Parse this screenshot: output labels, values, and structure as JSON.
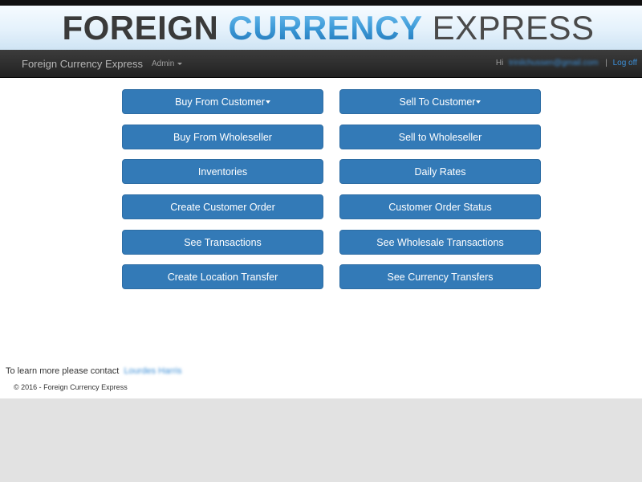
{
  "banner": {
    "logo_word1": "FOREIGN",
    "logo_word2": "CURRENCY",
    "logo_word3": "EXPRESS"
  },
  "navbar": {
    "brand": "Foreign Currency Express",
    "admin_menu": "Admin",
    "greeting": "Hi",
    "user_email": "trinilchussen@gmail.com",
    "separator": "|",
    "logoff": "Log off"
  },
  "buttons": {
    "buy_from_customer": "Buy From Customer",
    "sell_to_customer": "Sell To Customer",
    "buy_from_wholeseller": "Buy From Wholeseller",
    "sell_to_wholeseller": "Sell to Wholeseller",
    "inventories": "Inventories",
    "daily_rates": "Daily Rates",
    "create_customer_order": "Create Customer Order",
    "customer_order_status": "Customer Order Status",
    "see_transactions": "See Transactions",
    "see_wholesale_transactions": "See Wholesale Transactions",
    "create_location_transfer": "Create Location Transfer",
    "see_currency_transfers": "See Currency Transfers"
  },
  "contact": {
    "text": "To learn more please contact",
    "name": "Lourdes Harris"
  },
  "footer": {
    "text": "© 2016 - Foreign Currency Express"
  },
  "colors": {
    "button_bg": "#337ab7",
    "navbar_bg": "#222222",
    "link": "#3b8ed6",
    "page_bg": "#e2e2e2"
  }
}
